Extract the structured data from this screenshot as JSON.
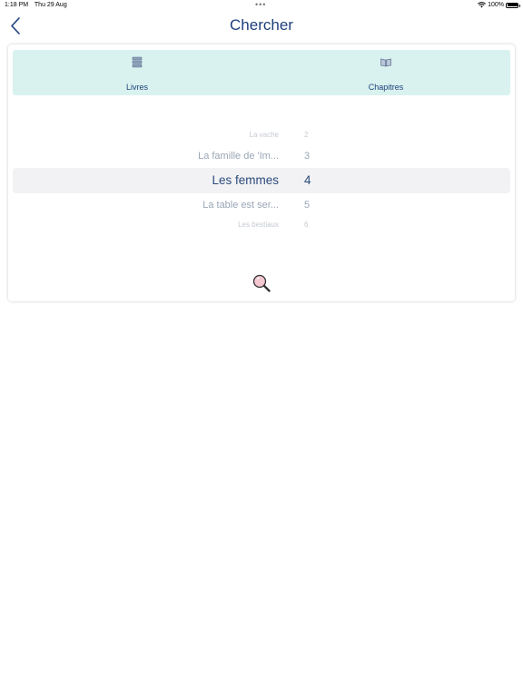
{
  "status": {
    "time": "1:18 PM",
    "date": "Thu 29 Aug",
    "battery": "100%"
  },
  "nav": {
    "title": "Chercher"
  },
  "tabs": [
    {
      "label": "Livres",
      "icon": "books-icon"
    },
    {
      "label": "Chapitres",
      "icon": "open-book-icon"
    }
  ],
  "picker": {
    "rows": [
      {
        "name": "La vache",
        "num": "2"
      },
      {
        "name": "La famille de 'Im...",
        "num": "3"
      },
      {
        "name": "Les femmes",
        "num": "4"
      },
      {
        "name": "La table est ser...",
        "num": "5"
      },
      {
        "name": "Les bestiaux",
        "num": "6"
      }
    ],
    "selected_index": 2
  },
  "colors": {
    "accent": "#1d3f7b",
    "tab_bg": "#d9f2ef",
    "highlight": "#f2f2f4"
  }
}
